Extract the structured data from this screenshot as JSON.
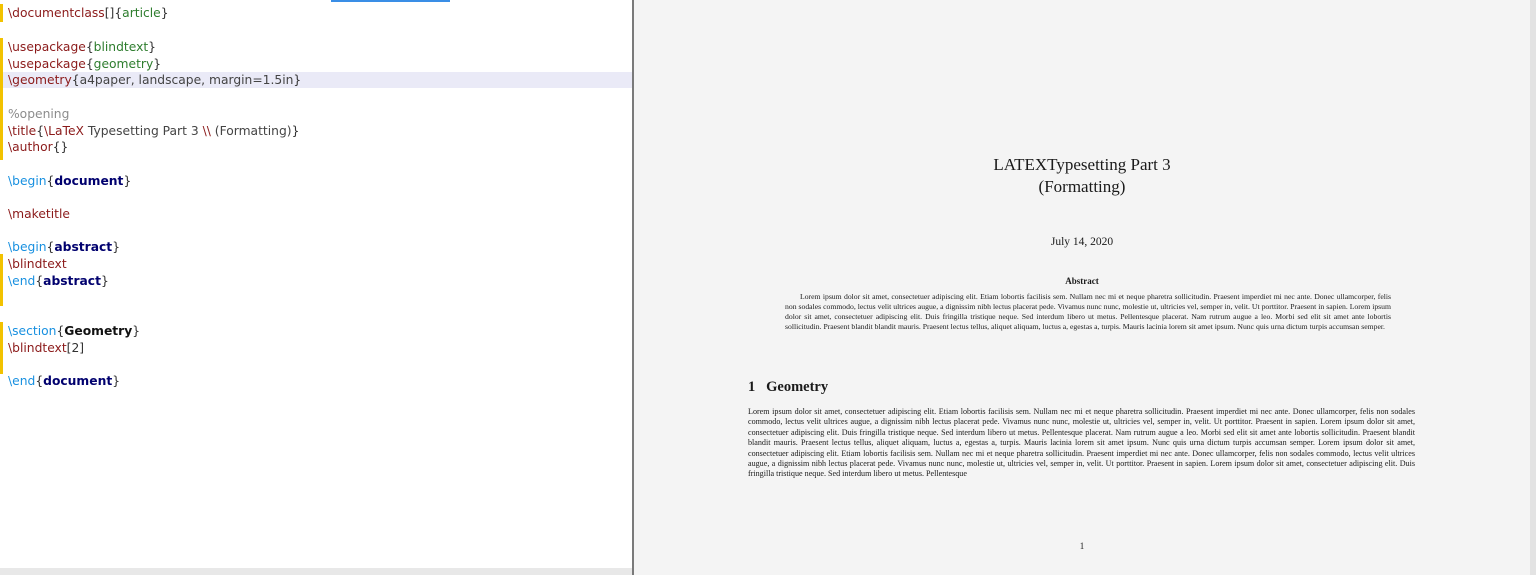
{
  "editor": {
    "lines": {
      "l1": {
        "cmd": "\\documentclass",
        "opt": "[]",
        "arg_open": "{",
        "arg": "article",
        "arg_close": "}"
      },
      "l3": {
        "cmd": "\\usepackage",
        "arg_open": "{",
        "arg": "blindtext",
        "arg_close": "}"
      },
      "l4": {
        "cmd": "\\usepackage",
        "arg_open": "{",
        "arg": "geometry",
        "arg_close": "}"
      },
      "l5": {
        "cmd": "\\geometry",
        "arg_open": "{",
        "arg": "a4paper, landscape, margin=1.5in",
        "arg_close": "}"
      },
      "l7": {
        "comment": "%opening"
      },
      "l8": {
        "cmd": "\\title",
        "arg_open": "{",
        "inner_cmd": "\\LaTeX",
        "text": " Typesetting Part 3 ",
        "linebreak": "\\\\",
        "text2": " (Formatting)",
        "arg_close": "}"
      },
      "l9": {
        "cmd": "\\author",
        "arg": "{}"
      },
      "l11": {
        "env": "\\begin",
        "open": "{",
        "name": "document",
        "close": "}"
      },
      "l13": {
        "cmd": "\\maketitle"
      },
      "l15": {
        "env": "\\begin",
        "open": "{",
        "name": "abstract",
        "close": "}"
      },
      "l16": {
        "cmd": "\\blindtext"
      },
      "l17": {
        "env": "\\end",
        "open": "{",
        "name": "abstract",
        "close": "}"
      },
      "l20": {
        "cmd": "\\section",
        "open": "{",
        "name": "Geometry",
        "close": "}"
      },
      "l21": {
        "cmd": "\\blindtext",
        "opt": "[2]"
      },
      "l23": {
        "env": "\\end",
        "open": "{",
        "name": "document",
        "close": "}"
      }
    }
  },
  "preview": {
    "title_line1": "LATEXTypesetting Part 3",
    "title_line2": "(Formatting)",
    "date": "July 14, 2020",
    "abstract_heading": "Abstract",
    "abstract_text": "Lorem ipsum dolor sit amet, consectetuer adipiscing elit. Etiam lobortis facilisis sem. Nullam nec mi et neque pharetra sollicitudin. Praesent imperdiet mi nec ante. Donec ullamcorper, felis non sodales commodo, lectus velit ultrices augue, a dignissim nibh lectus placerat pede. Vivamus nunc nunc, molestie ut, ultricies vel, semper in, velit. Ut porttitor. Praesent in sapien. Lorem ipsum dolor sit amet, consectetuer adipiscing elit. Duis fringilla tristique neque. Sed interdum libero ut metus. Pellentesque placerat. Nam rutrum augue a leo. Morbi sed elit sit amet ante lobortis sollicitudin. Praesent blandit blandit mauris. Praesent lectus tellus, aliquet aliquam, luctus a, egestas a, turpis. Mauris lacinia lorem sit amet ipsum. Nunc quis urna dictum turpis accumsan semper.",
    "section_number": "1",
    "section_title": "Geometry",
    "section_text": "Lorem ipsum dolor sit amet, consectetuer adipiscing elit. Etiam lobortis facilisis sem. Nullam nec mi et neque pharetra sollicitudin. Praesent imperdiet mi nec ante. Donec ullamcorper, felis non sodales commodo, lectus velit ultrices augue, a dignissim nibh lectus placerat pede. Vivamus nunc nunc, molestie ut, ultricies vel, semper in, velit. Ut porttitor. Praesent in sapien. Lorem ipsum dolor sit amet, consectetuer adipiscing elit. Duis fringilla tristique neque. Sed interdum libero ut metus. Pellentesque placerat. Nam rutrum augue a leo. Morbi sed elit sit amet ante lobortis sollicitudin. Praesent blandit blandit mauris. Praesent lectus tellus, aliquet aliquam, luctus a, egestas a, turpis. Mauris lacinia lorem sit amet ipsum. Nunc quis urna dictum turpis accumsan semper. Lorem ipsum dolor sit amet, consectetuer adipiscing elit. Etiam lobortis facilisis sem. Nullam nec mi et neque pharetra sollicitudin. Praesent imperdiet mi nec ante. Donec ullamcorper, felis non sodales commodo, lectus velit ultrices augue, a dignissim nibh lectus placerat pede. Vivamus nunc nunc, molestie ut, ultricies vel, semper in, velit. Ut porttitor. Praesent in sapien. Lorem ipsum dolor sit amet, consectetuer adipiscing elit. Duis fringilla tristique neque. Sed interdum libero ut metus. Pellentesque",
    "page_number": "1"
  }
}
